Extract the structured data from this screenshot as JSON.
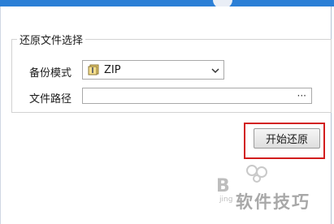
{
  "restore_panel": {
    "group_title": "还原文件选择",
    "backup_mode": {
      "label": "备份模式",
      "value": "ZIP",
      "icon": "zip-file-icon"
    },
    "file_path": {
      "label": "文件路径",
      "value": "",
      "browse_label": "···"
    }
  },
  "actions": {
    "start_restore_label": "开始还原"
  },
  "watermark": {
    "text": "软件技巧"
  },
  "colors": {
    "highlight_border": "#d21d1d",
    "title_strip": "#2b7fd6"
  }
}
